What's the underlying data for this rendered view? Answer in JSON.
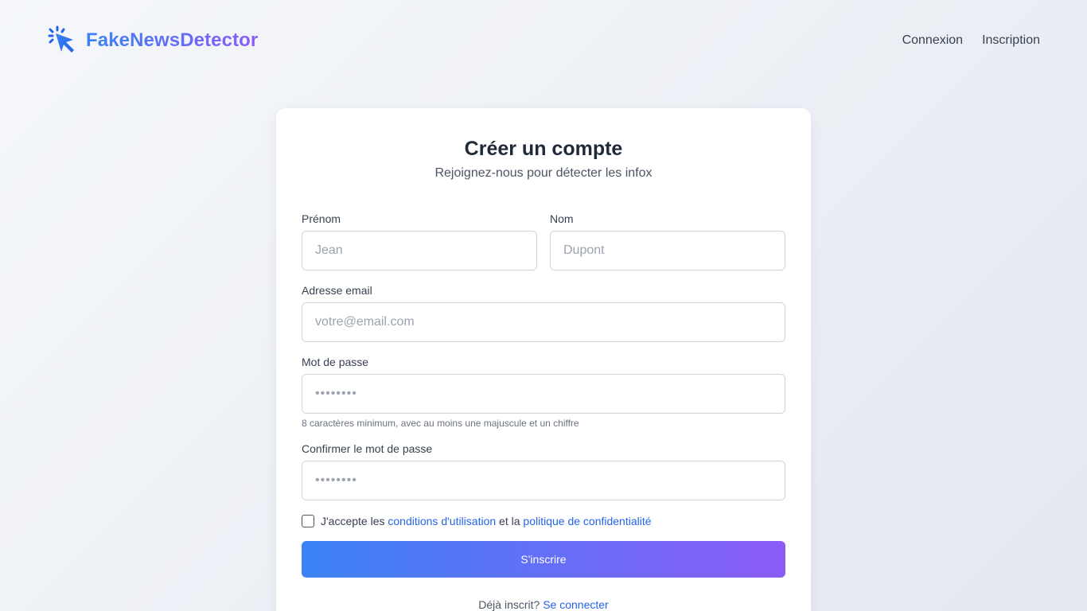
{
  "brand": {
    "name": "FakeNewsDetector",
    "icon": "cursor-click-icon",
    "gradient_start": "#3b82f6",
    "gradient_end": "#8b5cf6"
  },
  "nav": {
    "login": "Connexion",
    "signup": "Inscription"
  },
  "form": {
    "title": "Créer un compte",
    "subtitle": "Rejoignez-nous pour détecter les infox",
    "first_name": {
      "label": "Prénom",
      "placeholder": "Jean",
      "value": ""
    },
    "last_name": {
      "label": "Nom",
      "placeholder": "Dupont",
      "value": ""
    },
    "email": {
      "label": "Adresse email",
      "placeholder": "votre@email.com",
      "value": ""
    },
    "password": {
      "label": "Mot de passe",
      "placeholder": "••••••••",
      "value": "",
      "hint": "8 caractères minimum, avec au moins une majuscule et un chiffre"
    },
    "confirm_password": {
      "label": "Confirmer le mot de passe",
      "placeholder": "••••••••",
      "value": ""
    },
    "terms": {
      "checked": false,
      "prefix": "J'accepte les",
      "terms_link": "conditions d'utilisation",
      "middle": "et la",
      "privacy_link": "politique de confidentialité"
    },
    "submit_label": "S'inscrire",
    "already_registered": "Déjà inscrit?",
    "login_link": "Se connecter"
  },
  "colors": {
    "link": "#2563eb",
    "button_start": "#3b82f6",
    "button_end": "#8b5cf6"
  }
}
